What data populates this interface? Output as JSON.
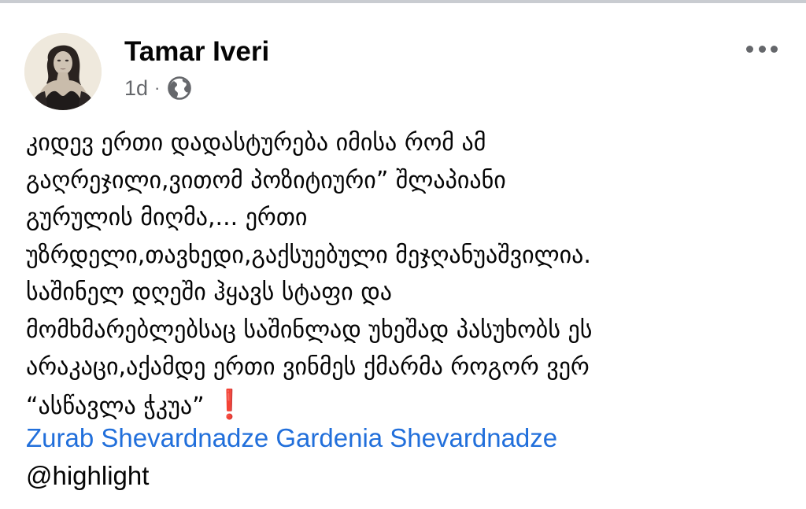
{
  "author": {
    "name": "Tamar Iveri"
  },
  "meta": {
    "time": "1d",
    "separator": "·",
    "audience_icon": "globe-icon"
  },
  "more_icon": "more-horizontal-icon",
  "post": {
    "lines": [
      "კიდევ ერთი დადასტურება იმისა რომ ამ",
      "გაღრეჯილი,ვითომ პოზიტიური” შლაპიანი",
      "გურულის მიღმა,... ერთი",
      "უზრდელი,თავხედი,გაქსუებული მეჯღანუაშვილია.",
      "საშინელ დღეში ჰყავს სტაფი და",
      "მომხმარებლებსაც საშინლად უხეშად პასუხობს ეს",
      "არაკაცი,აქამდე ერთი ვინმეს ქმარმა როგორ ვერ",
      "“ასწავლა ჭკუა” "
    ],
    "emoji": "❗",
    "tags": [
      "Zurab Shevardnadze",
      "Gardenia Shevardnadze"
    ],
    "mention": "@highlight"
  },
  "colors": {
    "link": "#216fdb",
    "meta": "#65676b",
    "text": "#050505",
    "exclaim": "#e4202b"
  }
}
